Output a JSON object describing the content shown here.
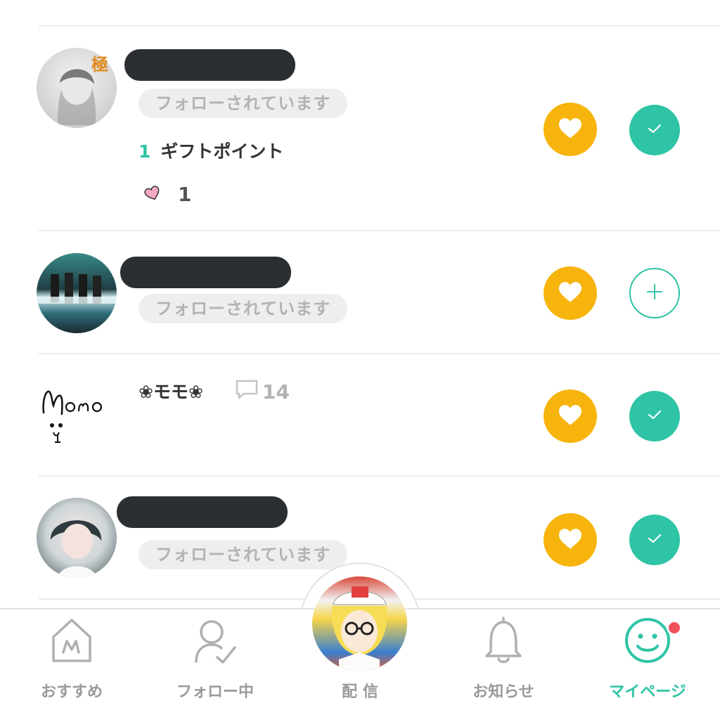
{
  "colors": {
    "accent": "#2ec4a5",
    "heart": "#f7b40c",
    "badge_bg": "#eeeeee",
    "badge_text": "#b3b3b3",
    "notification": "#f0505a"
  },
  "rows": [
    {
      "name_hidden": true,
      "badge": "フォローされています",
      "avatar_mark": "極",
      "gift_points_count": "1",
      "gift_points_label": "ギフトポイント",
      "likes_count": "1",
      "heart_button": "heart-icon",
      "follow_state": "following"
    },
    {
      "name_hidden": true,
      "badge": "フォローされています",
      "heart_button": "heart-icon",
      "follow_state": "not-following"
    },
    {
      "name": "❀モモ❀",
      "comment_count": "14",
      "heart_button": "heart-icon",
      "follow_state": "following"
    },
    {
      "name_hidden": true,
      "badge": "フォローされています",
      "heart_button": "heart-icon",
      "follow_state": "following"
    }
  ],
  "tabbar": {
    "recommended": {
      "label": "おすすめ",
      "icon": "home-icon"
    },
    "following": {
      "label": "フォロー中",
      "icon": "user-check-icon"
    },
    "broadcast": {
      "label": "配 信",
      "icon": "avatar"
    },
    "notifications": {
      "label": "お知らせ",
      "icon": "bell-icon"
    },
    "mypage": {
      "label": "マイページ",
      "icon": "smiley-icon",
      "active": true,
      "has_notification": true
    }
  }
}
